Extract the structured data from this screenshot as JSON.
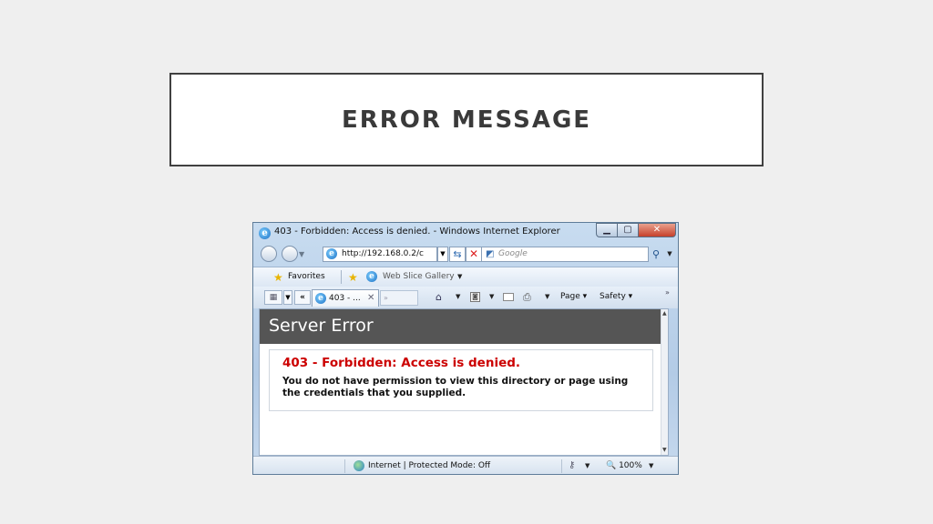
{
  "slide": {
    "title": "ERROR MESSAGE"
  },
  "browser": {
    "window_title": "403 - Forbidden: Access is denied. - Windows Internet Explorer",
    "address": "http://192.168.0.2/c",
    "search_placeholder": "Google",
    "favorites_label": "Favorites",
    "web_slice_label": "Web Slice Gallery",
    "tab_label": "403 - ...",
    "page_menu": "Page",
    "safety_menu": "Safety",
    "status_zone": "Internet | Protected Mode: Off",
    "zoom": "100%"
  },
  "content": {
    "header": "Server Error",
    "error_heading": "403 - Forbidden: Access is denied.",
    "error_text": "You do not have permission to view this directory or page using the credentials that you supplied."
  },
  "colors": {
    "error_red": "#cc0000",
    "header_gray": "#555555",
    "window_frame": "#b3cbe6"
  },
  "icons": [
    "ie-logo-icon",
    "back-icon",
    "forward-icon",
    "refresh-icon",
    "stop-icon",
    "search-icon",
    "star-icon",
    "home-icon",
    "feed-icon",
    "mail-icon",
    "print-icon",
    "globe-icon",
    "lock-icon"
  ]
}
